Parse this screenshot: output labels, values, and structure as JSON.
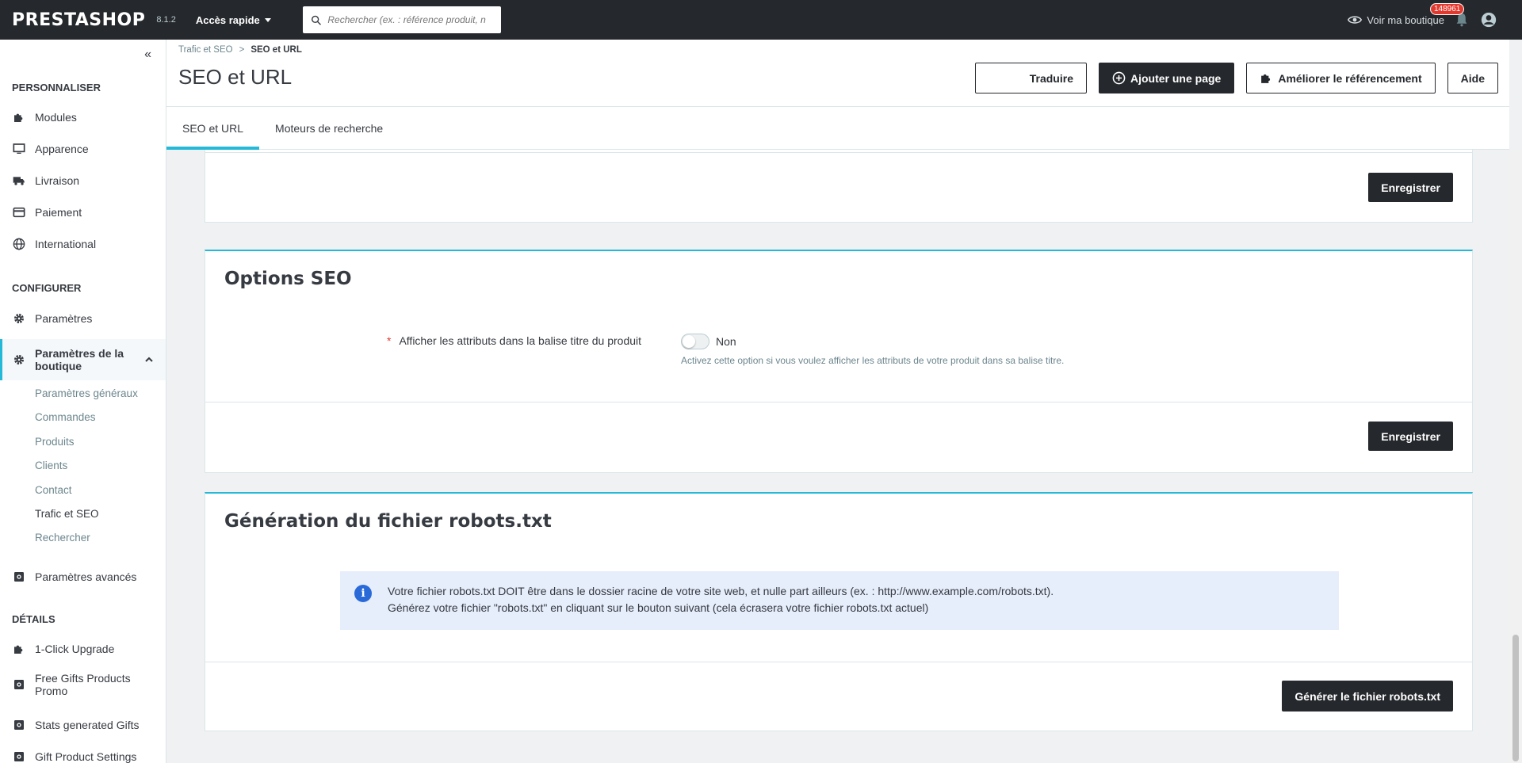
{
  "topbar": {
    "logo": "PRESTASHOP",
    "version": "8.1.2",
    "quick_access": "Accès rapide",
    "search_placeholder": "Rechercher (ex. : référence produit, n",
    "view_shop": "Voir ma boutique",
    "notifications_count": "148961"
  },
  "sidebar": {
    "sections": [
      {
        "title": "PERSONNALISER"
      },
      {
        "title": "CONFIGURER"
      },
      {
        "title": "DÉTAILS"
      }
    ],
    "personnaliser": [
      {
        "label": "Modules",
        "icon": "puzzle-icon"
      },
      {
        "label": "Apparence",
        "icon": "desktop-icon"
      },
      {
        "label": "Livraison",
        "icon": "truck-icon"
      },
      {
        "label": "Paiement",
        "icon": "credit-card-icon"
      },
      {
        "label": "International",
        "icon": "globe-icon"
      }
    ],
    "configurer": [
      {
        "label": "Paramètres",
        "icon": "gear-icon"
      },
      {
        "label": "Paramètres de la boutique",
        "icon": "gear-icon"
      }
    ],
    "sub_items": [
      "Paramètres généraux",
      "Commandes",
      "Produits",
      "Clients",
      "Contact",
      "Trafic et SEO",
      "Rechercher"
    ],
    "advanced": {
      "label": "Paramètres avancés",
      "icon": "module-icon"
    },
    "details": [
      {
        "label": "1-Click Upgrade",
        "icon": "puzzle-icon"
      },
      {
        "label": "Free Gifts Products Promo",
        "icon": "module-icon"
      },
      {
        "label": "Stats generated Gifts",
        "icon": "module-icon"
      },
      {
        "label": "Gift Product Settings",
        "icon": "module-icon"
      }
    ]
  },
  "header": {
    "breadcrumb": [
      "Trafic et SEO",
      "SEO et URL"
    ],
    "breadcrumb_sep": ">",
    "title": "SEO et URL",
    "buttons": {
      "translate": "Traduire",
      "add_page": "Ajouter une page",
      "improve_seo": "Améliorer le référencement",
      "help": "Aide"
    }
  },
  "tabs": [
    {
      "label": "SEO et URL",
      "active": true
    },
    {
      "label": "Moteurs de recherche",
      "active": false
    }
  ],
  "panels": {
    "top_save": "Enregistrer",
    "seo_options": {
      "title": "Options SEO",
      "field_label": "Afficher les attributs dans la balise titre du produit",
      "required_mark": "*",
      "switch_value": "Non",
      "help": "Activez cette option si vous voulez afficher les attributs de votre produit dans sa balise titre.",
      "save": "Enregistrer"
    },
    "robots": {
      "title": "Génération du fichier robots.txt",
      "alert_line1": "Votre fichier robots.txt DOIT être dans le dossier racine de votre site web, et nulle part ailleurs (ex. : http://www.example.com/robots.txt).",
      "alert_line2": "Générez votre fichier \"robots.txt\" en cliquant sur le bouton suivant (cela écrasera votre fichier robots.txt actuel)",
      "generate": "Générer le fichier robots.txt"
    }
  },
  "colors": {
    "accent": "#25b9d7",
    "dark": "#25282c",
    "info_bg": "#e6edfb",
    "info_icon": "#2a6ad8",
    "danger": "#e2392f"
  }
}
